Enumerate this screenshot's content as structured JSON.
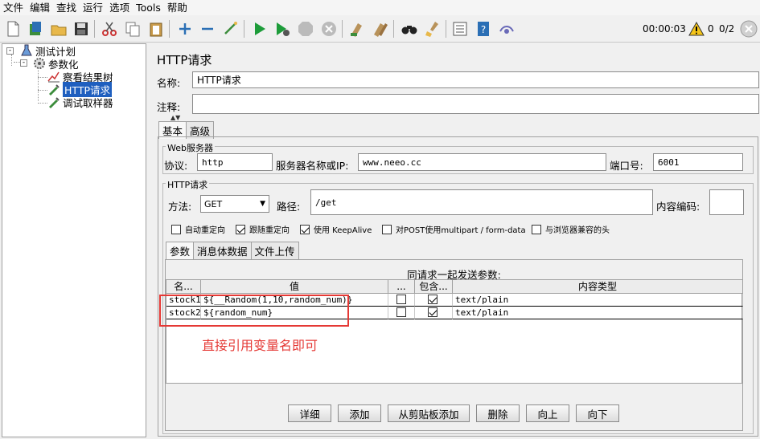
{
  "menu": [
    "文件",
    "编辑",
    "查找",
    "运行",
    "选项",
    "Tools",
    "帮助"
  ],
  "toolbar": {
    "icons": [
      "new-icon",
      "templates-icon",
      "open-icon",
      "save-icon",
      "cut-icon",
      "copy-icon",
      "paste-icon",
      "expand-icon",
      "collapse-icon",
      "toggle-icon",
      "start-icon",
      "start-no-pause-icon",
      "stop-icon",
      "shutdown-icon",
      "clear-icon",
      "clear-all-icon",
      "search-icon",
      "reset-search-icon",
      "function-helper-icon",
      "help-icon",
      "remote-icon"
    ],
    "timer": "00:00:03",
    "warnings": "0",
    "threads": "0/2"
  },
  "tree": {
    "items": [
      {
        "label": "测试计划"
      },
      {
        "label": "参数化"
      },
      {
        "label": "察看结果树"
      },
      {
        "label": "HTTP请求"
      },
      {
        "label": "调试取样器"
      }
    ]
  },
  "panel": {
    "title": "HTTP请求",
    "name_label": "名称:",
    "name_value": "HTTP请求",
    "comment_label": "注释:",
    "comment_value": "",
    "tabs": [
      "基本",
      "高级"
    ],
    "web_server": {
      "title": "Web服务器",
      "protocol_label": "协议:",
      "protocol_value": "http",
      "server_label": "服务器名称或IP:",
      "server_value": "www.neeo.cc",
      "port_label": "端口号:",
      "port_value": "6001"
    },
    "http_request": {
      "title": "HTTP请求",
      "method_label": "方法:",
      "method_value": "GET",
      "path_label": "路径:",
      "path_value": "/get",
      "encoding_label": "内容编码:",
      "encoding_value": "",
      "checkboxes": [
        {
          "label": "自动重定向",
          "checked": false
        },
        {
          "label": "跟随重定向",
          "checked": true
        },
        {
          "label": "使用 KeepAlive",
          "checked": true
        },
        {
          "label": "对POST使用multipart / form-data",
          "checked": false
        },
        {
          "label": "与浏览器兼容的头",
          "checked": false
        }
      ]
    },
    "param_tabs": [
      "参数",
      "消息体数据",
      "文件上传"
    ],
    "params_caption": "同请求一起发送参数:",
    "columns": [
      "名...",
      "值",
      "...",
      "包含...",
      "内容类型"
    ],
    "rows": [
      {
        "name": "stock1",
        "value": "${__Random(1,10,random_num)}",
        "encode": false,
        "include": true,
        "content_type": "text/plain"
      },
      {
        "name": "stock2",
        "value": "${random_num}",
        "encode": false,
        "include": true,
        "content_type": "text/plain"
      }
    ],
    "annotation": "直接引用变量名即可",
    "buttons": [
      "详细",
      "添加",
      "从剪贴板添加",
      "删除",
      "向上",
      "向下"
    ]
  },
  "colors": {
    "annotation": "#e53935",
    "selection": "#1f5fbf"
  }
}
